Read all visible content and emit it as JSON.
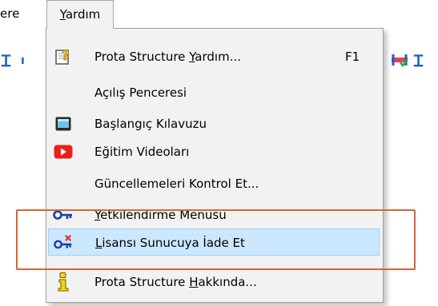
{
  "menubar": {
    "prev_item": "ere",
    "help_item": "Yardım",
    "help_item_underlined": "Y",
    "help_item_rest": "ardım"
  },
  "menu": {
    "items": [
      {
        "pre": "Prota Structure ",
        "u": "Y",
        "post": "ardım...",
        "shortcut": "F1",
        "icon": "help-question-icon"
      },
      {
        "pre": "Açılış Penceresi",
        "u": "",
        "post": "",
        "icon": ""
      },
      {
        "pre": "Başlangıç Kılavuzu",
        "u": "",
        "post": "",
        "icon": "guide-window-icon"
      },
      {
        "pre": "Eğitim Videoları",
        "u": "",
        "post": "",
        "icon": "video-play-icon"
      },
      {
        "pre": "Güncellemeleri Kontrol Et...",
        "u": "",
        "post": "",
        "icon": ""
      },
      {
        "pre": "",
        "u": "Y",
        "post": "etkilendirme Menüsü",
        "icon": "key-icon"
      },
      {
        "pre": "",
        "u": "L",
        "post": "isansı Sunucuya İade Et",
        "icon": "key-remove-icon"
      },
      {
        "pre": "Prota Structure ",
        "u": "H",
        "post": "akkında...",
        "icon": "info-icon"
      }
    ]
  }
}
